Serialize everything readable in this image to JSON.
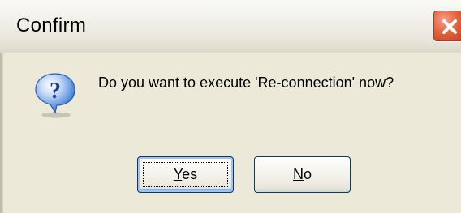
{
  "window": {
    "title": "Confirm"
  },
  "message": {
    "text": "Do you want to execute 'Re-connection' now?",
    "icon": "question-icon"
  },
  "buttons": {
    "yes": {
      "accel": "Y",
      "rest": "es"
    },
    "no": {
      "accel": "N",
      "rest": "o"
    }
  },
  "colors": {
    "dialog_background": "#ece9d8",
    "close_button": "#e2633f",
    "icon_blue": "#3a78d6"
  }
}
